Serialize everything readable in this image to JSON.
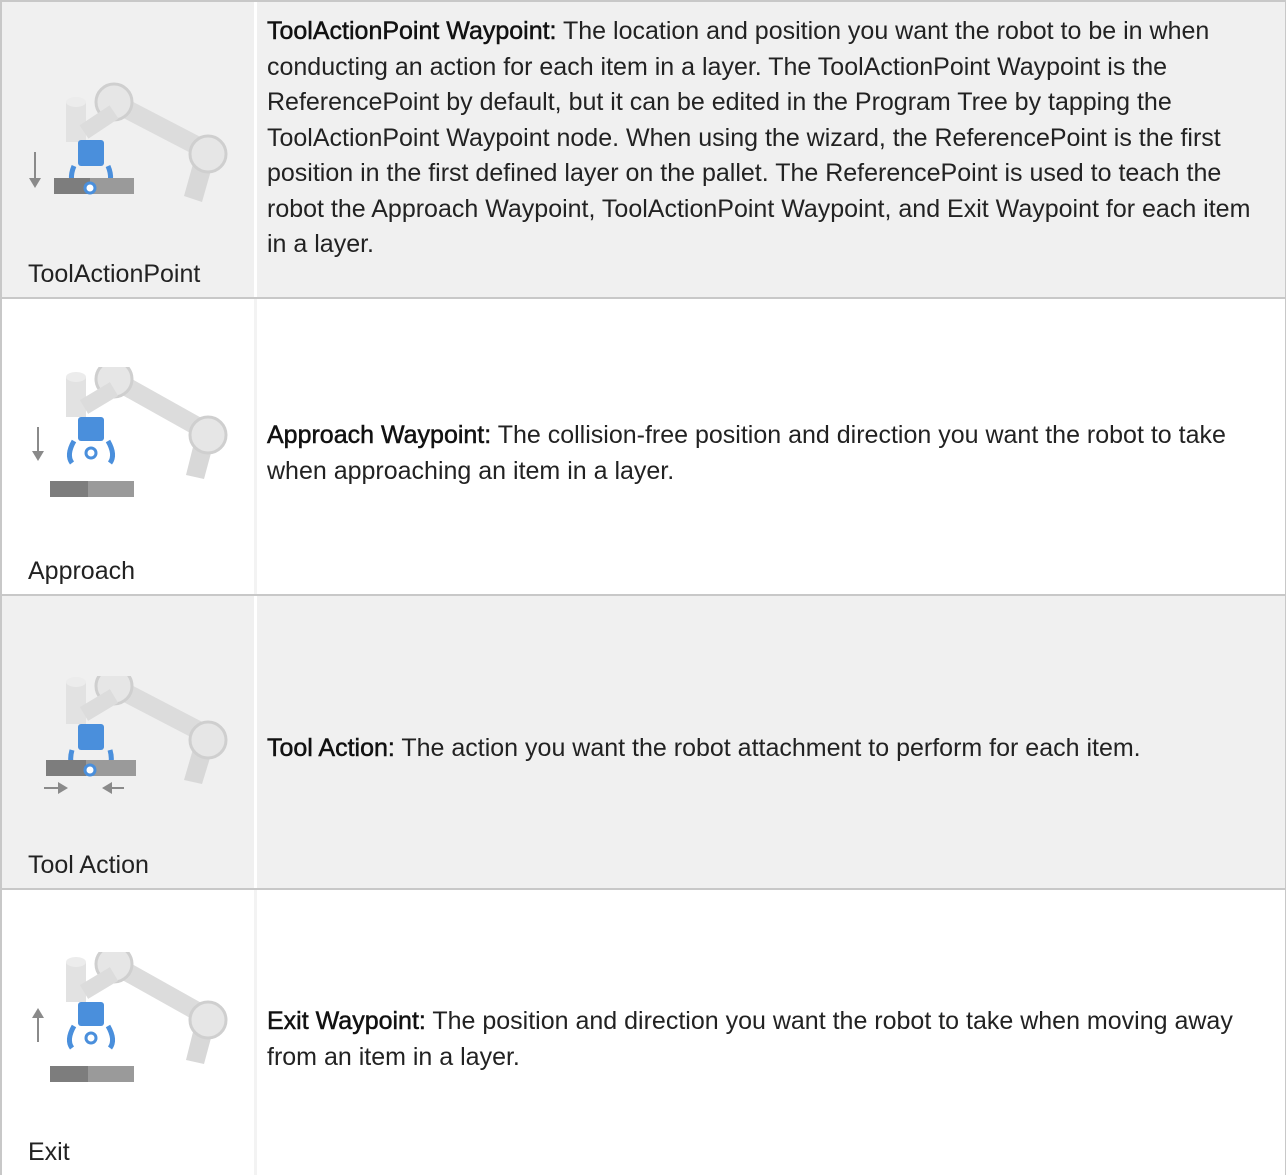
{
  "rows": [
    {
      "term": "ToolActionPoint Waypoint:",
      "description": " The location and position you want the robot to be in when conducting an action for each item in a layer. The ToolActionPoint Waypoint is the ReferencePoint by default, but it can be edited in the Program Tree by tapping the ToolActionPoint Waypoint node. When using the wizard, the ReferencePoint is the first position in the first defined layer on the pallet. The ReferencePoint is used to teach the robot the Approach Waypoint, ToolActionPoint Waypoint, and Exit Waypoint for each item in a layer.",
      "caption": "ToolActionPoint",
      "icon": "robot-arm-tool-action-point-icon"
    },
    {
      "term": "Approach Waypoint:",
      "description": " The collision-free position and direction you want the robot to take when approaching an item in a layer.",
      "caption": "Approach",
      "icon": "robot-arm-approach-icon"
    },
    {
      "term": "Tool Action:",
      "description": " The action you want the robot attachment to perform for each item.",
      "caption": "Tool Action",
      "icon": "robot-arm-tool-action-icon"
    },
    {
      "term": "Exit Waypoint:",
      "description": " The position and direction you want the robot to take when moving away from an item in a layer.",
      "caption": "Exit",
      "icon": "robot-arm-exit-icon"
    }
  ],
  "colors": {
    "row_shade": "#f0f0f0",
    "border": "#c8c8c8",
    "arm_gray": "#d6d6d6",
    "gripper_blue": "#4a8fdc",
    "box_gray": "#8a8a8a"
  }
}
